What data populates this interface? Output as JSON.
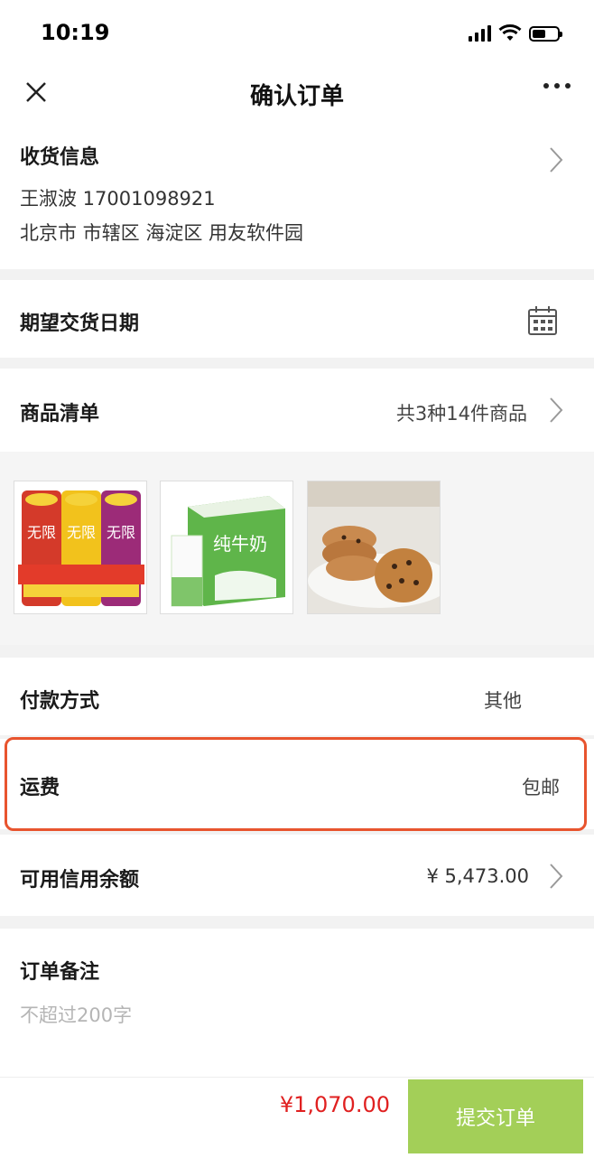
{
  "status_bar": {
    "time": "10:19"
  },
  "nav": {
    "title": "确认订单"
  },
  "address": {
    "title": "收货信息",
    "name_phone": "王淑波 17001098921",
    "address_line": "北京市 市辖区 海淀区 用友软件园"
  },
  "delivery_date": {
    "label": "期望交货日期"
  },
  "goods": {
    "label": "商品清单",
    "summary": "共3种14件商品",
    "images": [
      {
        "name": "potato-chips-product-image",
        "text_visible": "无限"
      },
      {
        "name": "pure-milk-product-image",
        "text_visible": "纯牛奶"
      },
      {
        "name": "cookies-product-image"
      }
    ]
  },
  "payment": {
    "label": "付款方式",
    "value": "其他"
  },
  "shipping": {
    "label": "运费",
    "value": "包邮"
  },
  "credit": {
    "label": "可用信用余额",
    "value": "¥ 5,473.00"
  },
  "note": {
    "label": "订单备注",
    "placeholder": "不超过200字"
  },
  "footer": {
    "total": "¥1,070.00",
    "submit_label": "提交订单"
  },
  "colors": {
    "accent": "#a3cf58",
    "price": "#e02020",
    "highlight": "#e8542e"
  }
}
